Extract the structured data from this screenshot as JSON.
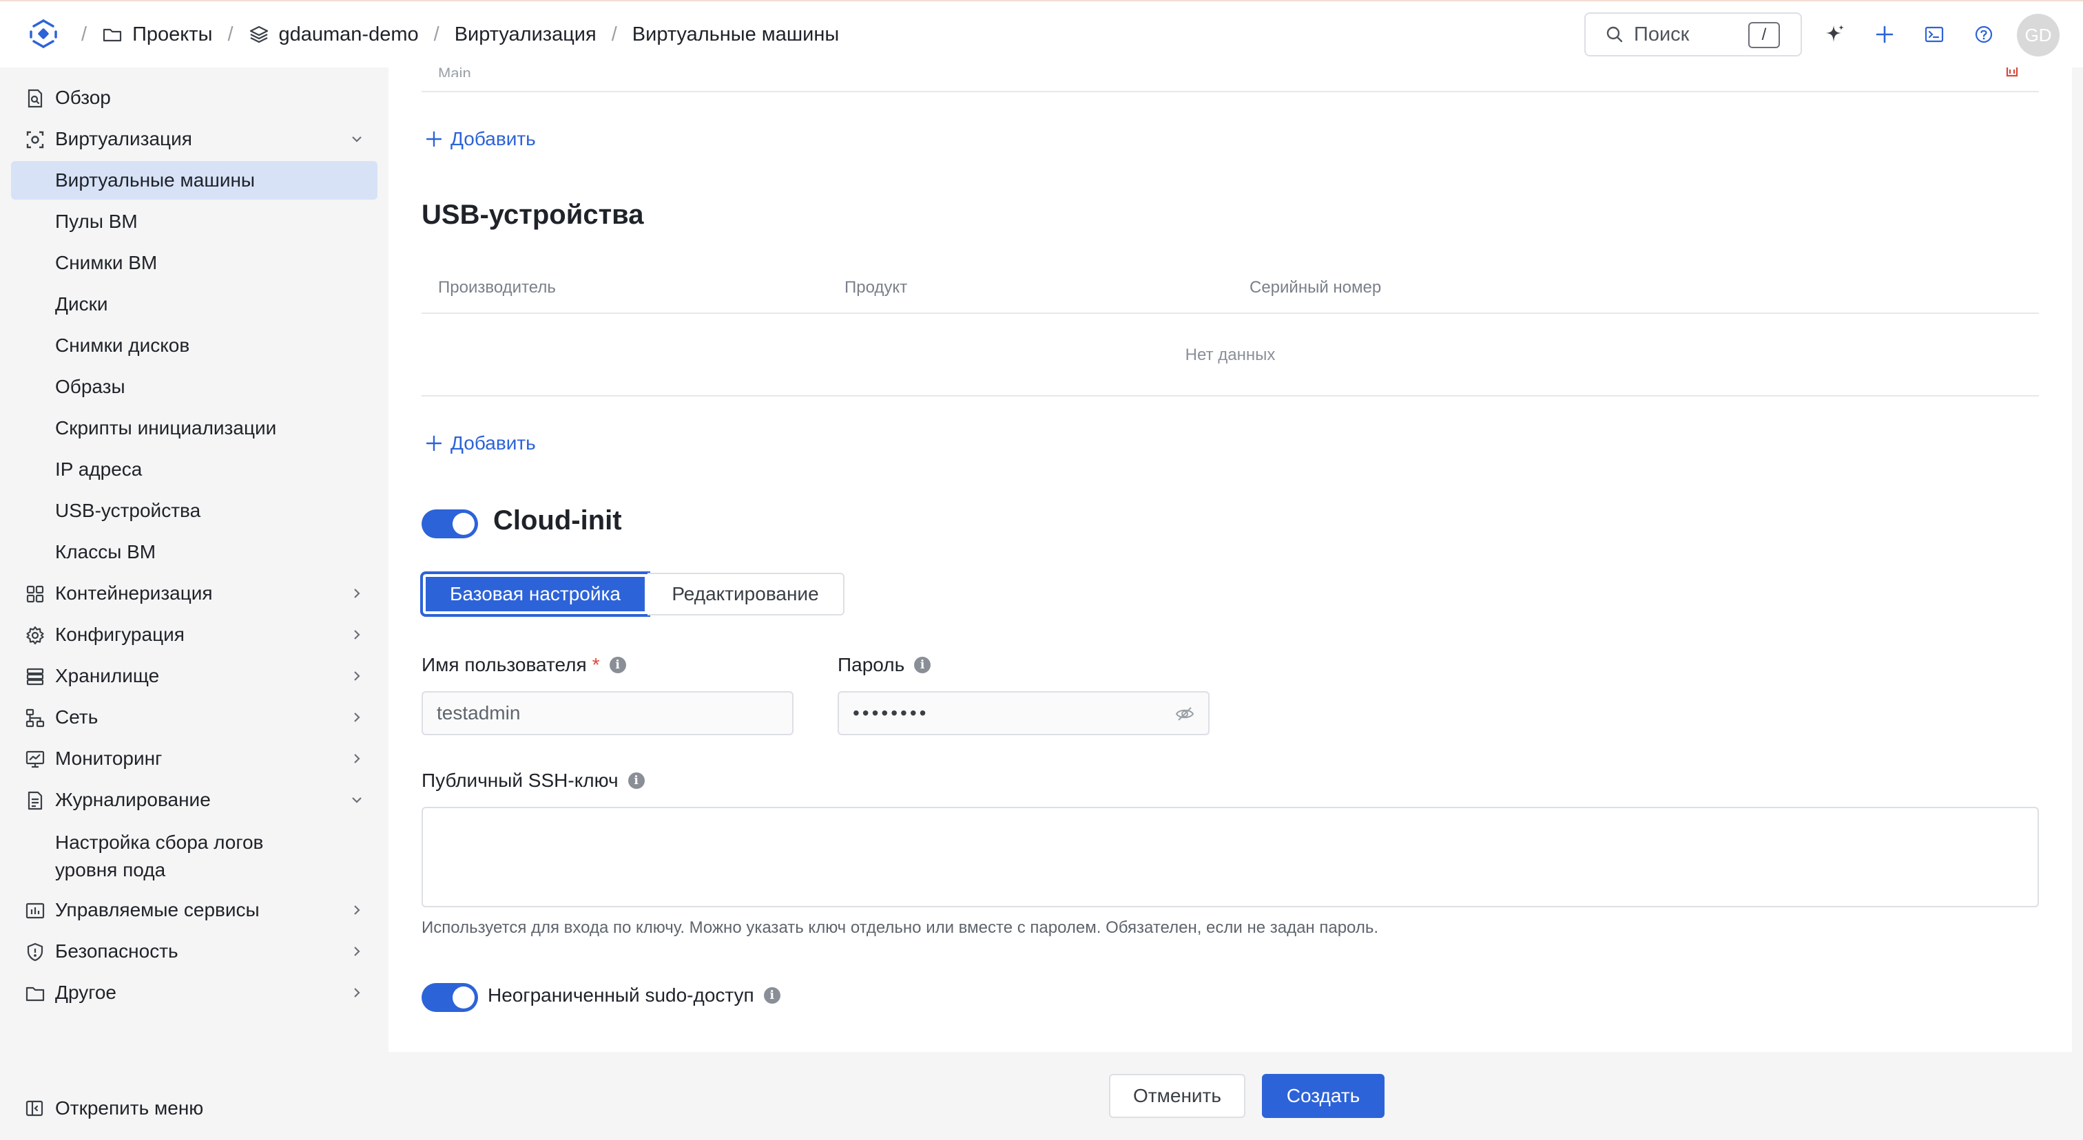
{
  "breadcrumbs": {
    "projects": "Проекты",
    "project": "gdauman-demo",
    "section": "Виртуализация",
    "page": "Виртуальные машины",
    "separator": "/"
  },
  "search": {
    "placeholder": "Поиск",
    "shortcut": "/"
  },
  "user": {
    "initials": "GD"
  },
  "sidebar": {
    "overview": "Обзор",
    "virtualization": "Виртуализация",
    "virt_items": [
      "Виртуальные машины",
      "Пулы ВМ",
      "Снимки ВМ",
      "Диски",
      "Снимки дисков",
      "Образы",
      "Скрипты инициализации",
      "IP адреса",
      "USB-устройства",
      "Классы ВМ"
    ],
    "containerization": "Контейнеризация",
    "configuration": "Конфигурация",
    "storage": "Хранилище",
    "network": "Сеть",
    "monitoring": "Мониторинг",
    "logging": "Журналирование",
    "logging_sub_line1": "Настройка сбора логов",
    "logging_sub_line2": "уровня пода",
    "managed_services": "Управляемые сервисы",
    "security": "Безопасность",
    "other": "Другое",
    "unpin": "Открепить меню"
  },
  "main": {
    "cut_row_text": "Main",
    "add_label": "Добавить",
    "usb": {
      "title": "USB-устройства",
      "columns": [
        "Производитель",
        "Продукт",
        "Серийный номер"
      ],
      "empty": "Нет данных"
    },
    "cloudinit": {
      "title": "Cloud-init",
      "enabled": true,
      "tabs": [
        "Базовая настройка",
        "Редактирование"
      ],
      "active_tab": "Базовая настройка",
      "username_label": "Имя пользователя",
      "required_mark": "*",
      "username_value": "testadmin",
      "password_label": "Пароль",
      "password_value": "••••••••",
      "ssh_label": "Публичный SSH-ключ",
      "ssh_value": "",
      "ssh_hint": "Используется для входа по ключу. Можно указать ключ отдельно или вместе с паролем. Обязателен, если не задан пароль.",
      "sudo_label": "Неограниченный sudo-доступ",
      "sudo_enabled": true
    }
  },
  "footer": {
    "cancel": "Отменить",
    "create": "Создать"
  },
  "colors": {
    "accent": "#2d63d8",
    "active_nav": "#d7e2f7",
    "required": "#e0453a"
  }
}
